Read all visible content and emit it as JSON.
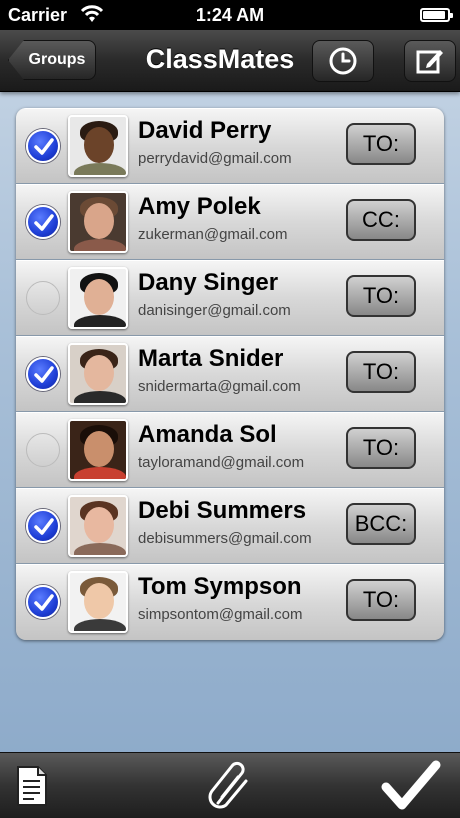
{
  "status_bar": {
    "carrier": "Carrier",
    "time": "1:24 AM"
  },
  "nav": {
    "back_label": "Groups",
    "title": "ClassMates",
    "right_icons": [
      "clock-icon",
      "compose-icon"
    ]
  },
  "contacts": [
    {
      "name": "David Perry",
      "email": "perrydavid@gmail.com",
      "checked": true,
      "recipient": "TO:"
    },
    {
      "name": "Amy Polek",
      "email": "zukerman@gmail.com",
      "checked": true,
      "recipient": "CC:"
    },
    {
      "name": "Dany Singer",
      "email": "danisinger@gmail.com",
      "checked": false,
      "recipient": "TO:"
    },
    {
      "name": "Marta Snider",
      "email": "snidermarta@gmail.com",
      "checked": true,
      "recipient": "TO:"
    },
    {
      "name": "Amanda Sol",
      "email": "tayloramand@gmail.com",
      "checked": false,
      "recipient": "TO:"
    },
    {
      "name": "Debi Summers",
      "email": "debisummers@gmail.com",
      "checked": true,
      "recipient": "BCC:"
    },
    {
      "name": "Tom Sympson",
      "email": "simpsontom@gmail.com",
      "checked": true,
      "recipient": "TO:"
    }
  ],
  "toolbar": {
    "icons": [
      "document-icon",
      "paperclip-icon",
      "checkmark-icon"
    ]
  },
  "colors": {
    "check_blue": "#1f3fd6",
    "nav_dark": "#2a2a2a",
    "background": "#a9c0d8"
  }
}
